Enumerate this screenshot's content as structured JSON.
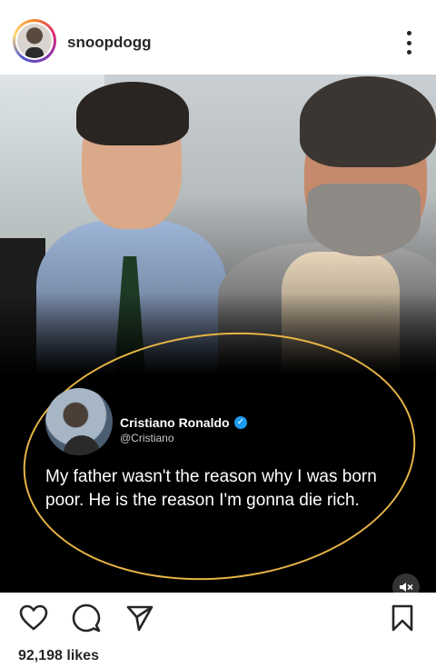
{
  "header": {
    "username": "snoopdogg"
  },
  "tweet": {
    "name": "Cristiano Ronaldo",
    "handle": "@Cristiano",
    "text": "My father wasn't the reason why I was born poor. He is the reason I'm gonna die rich."
  },
  "footer": {
    "likes": "92,198 likes"
  },
  "colors": {
    "accent_ellipse": "#e6b445",
    "verified": "#1d9bf0",
    "text": "#262626"
  },
  "icons": {
    "more": "more-vertical-icon",
    "like": "heart-icon",
    "comment": "comment-icon",
    "share": "send-icon",
    "save": "bookmark-icon",
    "mute": "speaker-muted-icon",
    "verified": "verified-badge-icon"
  }
}
